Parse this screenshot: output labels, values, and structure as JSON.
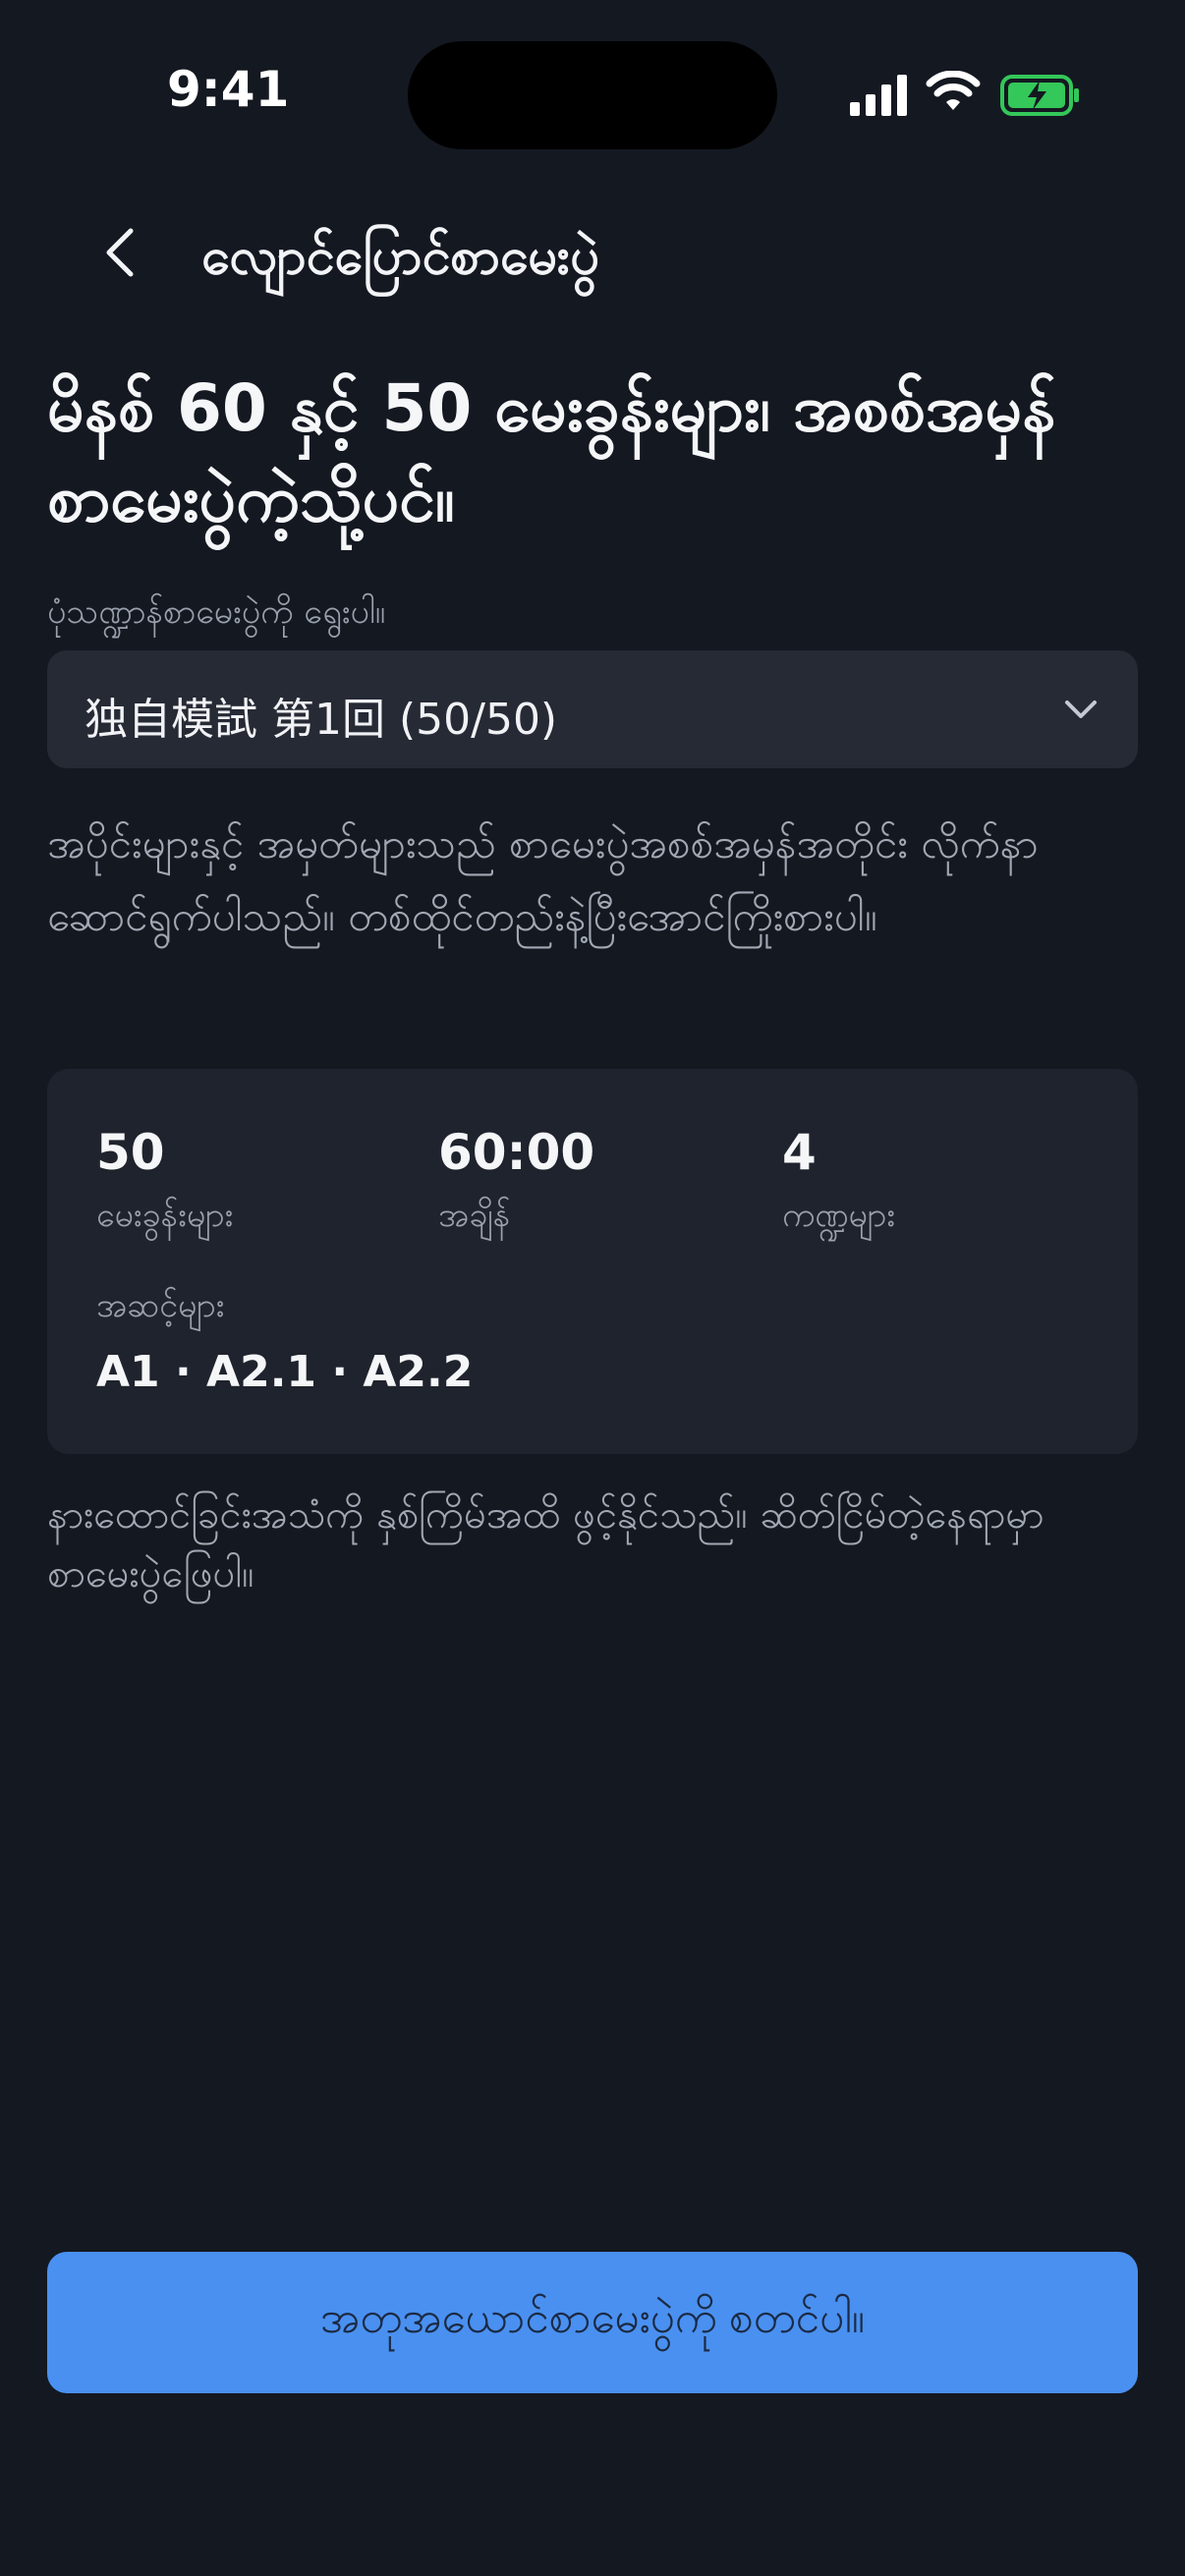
{
  "status_bar": {
    "time": "9:41",
    "battery_color": "#34c759"
  },
  "nav": {
    "title": "လျောင်ပြောင်စာမေးပွဲ"
  },
  "headline": "မိနစ် 60 နှင့် 50 မေးခွန်းများ၊ အစစ်အမှန်စာမေးပွဲကဲ့သို့ပင်။",
  "select": {
    "label": "ပုံသဏ္ဍာန်စာမေးပွဲကို ရွေးပါ။",
    "value": "独自模試 第1回 (50/50)"
  },
  "description": "အပိုင်းများနှင့် အမှတ်များသည် စာမေးပွဲအစစ်အမှန်အတိုင်း လိုက်နာဆောင်ရွက်ပါသည်။ တစ်ထိုင်တည်းနဲ့ပြီးအောင်ကြိုးစားပါ။",
  "stats": {
    "questions": {
      "value": "50",
      "label": "မေးခွန်းများ"
    },
    "time": {
      "value": "60:00",
      "label": "အချိန်"
    },
    "sections": {
      "value": "4",
      "label": "ကဏ္ဍများ"
    },
    "levels": {
      "label": "အဆင့်များ",
      "value": "A1 · A2.1 · A2.2"
    }
  },
  "note": "နားထောင်ခြင်းအသံကို နှစ်ကြိမ်အထိ ဖွင့်နိုင်သည်။ ဆိတ်ငြိမ်တဲ့နေရာမှာ စာမေးပွဲဖြေပါ။",
  "cta": {
    "label": "အတုအယောင်စာမေးပွဲကို စတင်ပါ။",
    "color": "#4a90f0"
  }
}
